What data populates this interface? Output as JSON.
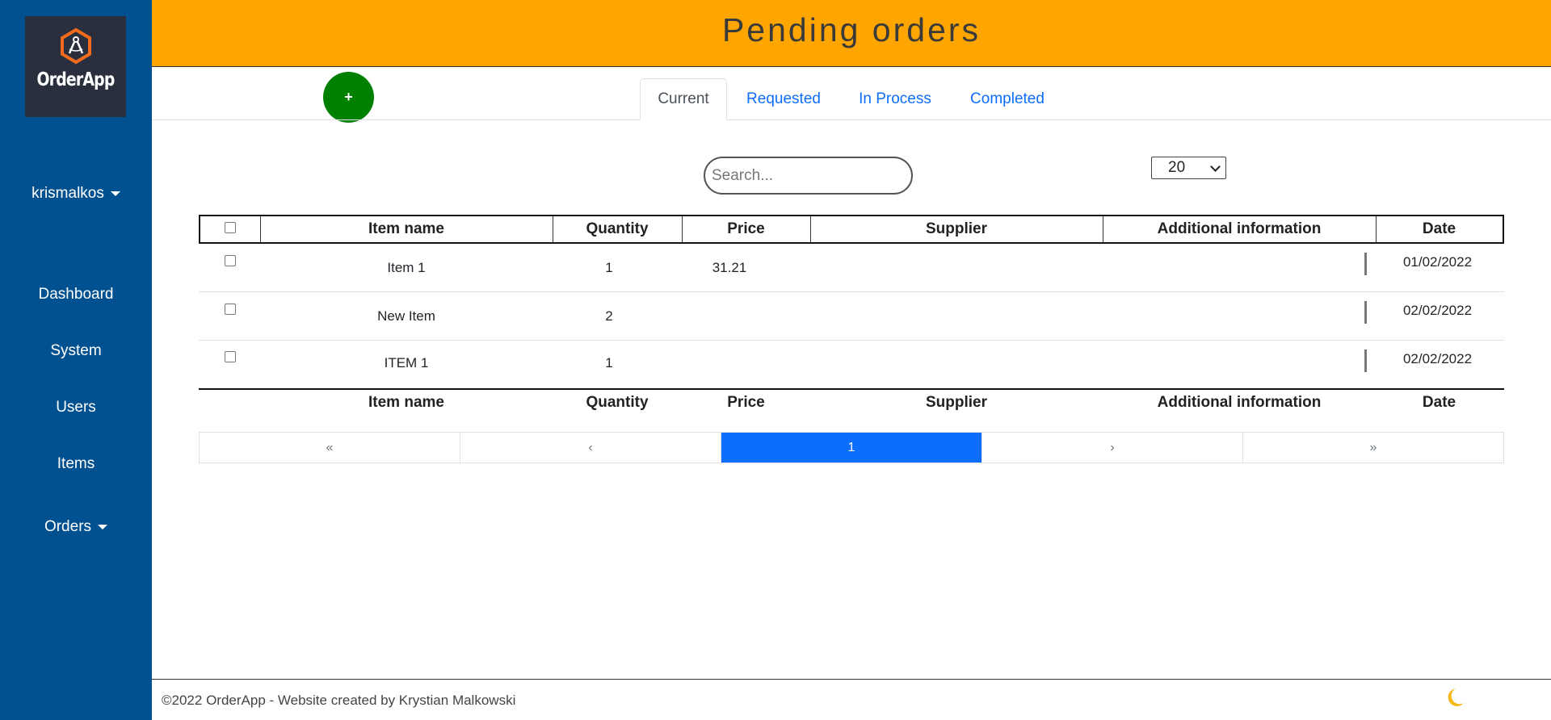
{
  "app": {
    "logo_text": "OrderApp"
  },
  "sidebar": {
    "user": "krismalkos",
    "items": [
      {
        "label": "Dashboard"
      },
      {
        "label": "System"
      },
      {
        "label": "Users"
      },
      {
        "label": "Items"
      },
      {
        "label": "Orders"
      }
    ]
  },
  "header": {
    "title": "Pending orders"
  },
  "toolbar": {
    "add_label": "+"
  },
  "tabs": [
    {
      "label": "Current",
      "active": true
    },
    {
      "label": "Requested"
    },
    {
      "label": "In Process"
    },
    {
      "label": "Completed"
    }
  ],
  "search": {
    "placeholder": "Search..."
  },
  "page_size": {
    "selected": "20"
  },
  "table": {
    "columns": [
      "Item name",
      "Quantity",
      "Price",
      "Supplier",
      "Additional information",
      "Date"
    ],
    "rows": [
      {
        "item": "Item 1",
        "quantity": "1",
        "price": "31.21",
        "supplier": "",
        "info": "",
        "date": "01/02/2022"
      },
      {
        "item": "New Item",
        "quantity": "2",
        "price": "",
        "supplier": "",
        "info": "",
        "date": "02/02/2022"
      },
      {
        "item": "ITEM 1",
        "quantity": "1",
        "price": "",
        "supplier": "",
        "info": "",
        "date": "02/02/2022"
      }
    ]
  },
  "pagination": {
    "first": "«",
    "prev": "‹",
    "current": "1",
    "next": "›",
    "last": "»"
  },
  "footer": {
    "text": "©2022 OrderApp - Website created by Krystian Malkowski"
  },
  "colors": {
    "sidebar": "#01508f",
    "header": "#ffa500",
    "add_button": "#008000",
    "active_page": "#0d6efd"
  }
}
